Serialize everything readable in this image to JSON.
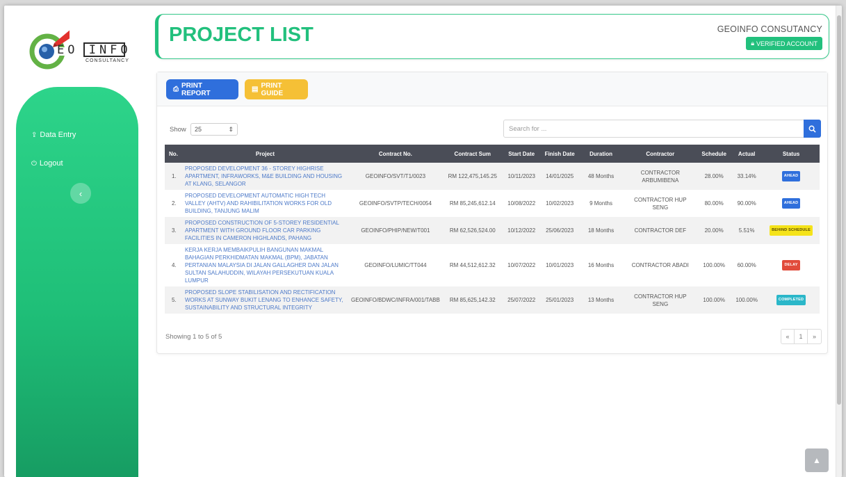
{
  "logo": {
    "letters": "EO INFO",
    "subtitle": "CONSULTANCY"
  },
  "sidebar": {
    "items": [
      {
        "label": "Data Entry",
        "icon": "upload-icon"
      },
      {
        "label": "Logout",
        "icon": "power-icon"
      }
    ],
    "collapse_icon": "chevron-left-icon"
  },
  "header": {
    "title": "PROJECT LIST",
    "company": "GEOINFO CONSUTANCY",
    "verified": "VERIFIED ACCOUNT"
  },
  "toolbar": {
    "print_report": "PRINT REPORT",
    "print_guide": "PRINT GUIDE"
  },
  "filters": {
    "show_label": "Show",
    "page_size": "25",
    "search_placeholder": "Search for ..."
  },
  "table": {
    "columns": [
      "No.",
      "Project",
      "Contract No.",
      "Contract Sum",
      "Start Date",
      "Finish Date",
      "Duration",
      "Contractor",
      "Schedule",
      "Actual",
      "Status"
    ],
    "rows": [
      {
        "no": "1.",
        "project": "PROPOSED DEVELOPMENT 36 - STOREY HIGHRISE APARTMENT, INFRAWORKS, M&E BUILDING AND HOUSING AT KLANG, SELANGOR",
        "contract_no": "GEOINFO/SVT/T1/0023",
        "sum": "RM 122,475,145.25",
        "start": "10/11/2023",
        "finish": "14/01/2025",
        "duration": "48 Months",
        "contractor": "CONTRACTOR ARBUMIBENA",
        "schedule": "28.00%",
        "actual": "33.14%",
        "status": "AHEAD",
        "status_color": "#2f6fdc",
        "status_text_color": "#ffffff"
      },
      {
        "no": "2.",
        "project": "PROPOSED DEVELOPMENT AUTOMATIC HIGH TECH VALLEY (AHTV) AND RAHIBILITATION WORKS FOR OLD BUILDING, TANJUNG MALIM",
        "contract_no": "GEOINFO/SVTP/TECH/0054",
        "sum": "RM 85,245,612.14",
        "start": "10/08/2022",
        "finish": "10/02/2023",
        "duration": "9 Months",
        "contractor": "CONTRACTOR HUP SENG",
        "schedule": "80.00%",
        "actual": "90.00%",
        "status": "AHEAD",
        "status_color": "#2f6fdc",
        "status_text_color": "#ffffff"
      },
      {
        "no": "3.",
        "project": "PROPOSED CONSTRUCTION OF 5-STOREY RESIDENTIAL APARTMENT WITH GROUND FLOOR CAR PARKING FACILITIES IN CAMERON HIGHLANDS, PAHANG",
        "contract_no": "GEOINFO/PHIP/NEW/T001",
        "sum": "RM 62,526,524.00",
        "start": "10/12/2022",
        "finish": "25/06/2023",
        "duration": "18 Months",
        "contractor": "CONTRACTOR DEF",
        "schedule": "20.00%",
        "actual": "5.51%",
        "status": "BEHIND SCHEDULE",
        "status_color": "#f5e31a",
        "status_text_color": "#5a4a00"
      },
      {
        "no": "4.",
        "project": "KERJA KERJA MEMBAIKPULIH BANGUNAN MAKMAL BAHAGIAN PERKHIDMATAN MAKMAL (BPM), JABATAN PERTANIAN MALAYSIA DI JALAN GALLAGHER DAN JALAN SULTAN SALAHUDDIN, WILAYAH PERSEKUTUAN KUALA LUMPUR",
        "contract_no": "GEOINFO/LUMIC/TT044",
        "sum": "RM 44,512,612.32",
        "start": "10/07/2022",
        "finish": "10/01/2023",
        "duration": "16 Months",
        "contractor": "CONTRACTOR ABADI",
        "schedule": "100.00%",
        "actual": "60.00%",
        "status": "DELAY",
        "status_color": "#e14b3b",
        "status_text_color": "#ffffff"
      },
      {
        "no": "5.",
        "project": "PROPOSED SLOPE STABILISATION AND RECTIFICATION WORKS AT SUNWAY BUKIT LENANG TO ENHANCE SAFETY, SUSTAINABILITY AND STRUCTURAL INTEGRITY",
        "contract_no": "GEOINFO/BDWC/INFRA/001/TABB",
        "sum": "RM 85,625,142.32",
        "start": "25/07/2022",
        "finish": "25/01/2023",
        "duration": "13 Months",
        "contractor": "CONTRACTOR HUP SENG",
        "schedule": "100.00%",
        "actual": "100.00%",
        "status": "COMPLETED",
        "status_color": "#2bb7c9",
        "status_text_color": "#ffffff"
      }
    ]
  },
  "footer": {
    "showing": "Showing 1 to 5 of 5",
    "pages": [
      "«",
      "1",
      "»"
    ]
  },
  "colors": {
    "brand": "#22c07d",
    "primary": "#2f6fdc",
    "warning": "#f5c036"
  }
}
